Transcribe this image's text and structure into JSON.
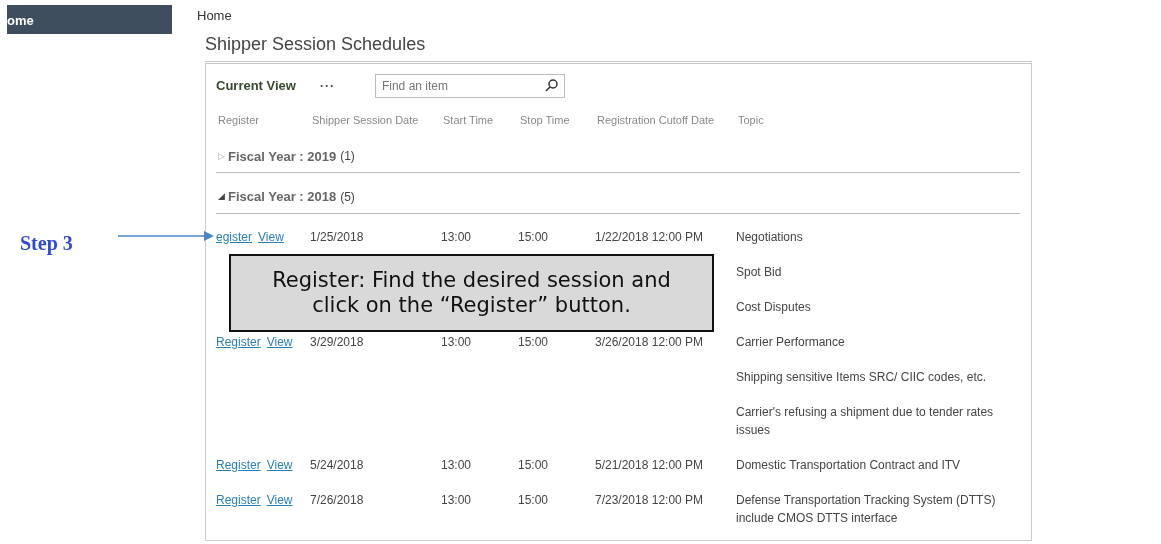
{
  "sidebar": {
    "items": [
      {
        "label": "ome",
        "selected": true
      }
    ]
  },
  "breadcrumb": "Home",
  "title": "Shipper Session Schedules",
  "toolbar": {
    "view_label": "Current View",
    "more": "···",
    "search": {
      "placeholder": "Find an item"
    }
  },
  "table": {
    "columns": [
      "Register",
      "Shipper Session Date",
      "Start Time",
      "Stop Time",
      "Registration Cutoff Date",
      "Topic"
    ],
    "groups": [
      {
        "toggle": "▷",
        "title": "Fiscal Year : 2019",
        "count": "(1)",
        "expanded": false
      },
      {
        "toggle": "◢",
        "title": "Fiscal Year : 2018",
        "count": "(5)",
        "expanded": true,
        "rows": [
          {
            "register": "egister",
            "view": "View",
            "date": "1/25/2018",
            "start": "13:00",
            "stop": "15:00",
            "cutoff": "1/22/2018 12:00 PM",
            "topic": "Negotiations"
          },
          {
            "topic": "Spot Bid"
          },
          {
            "topic": "Cost Disputes"
          },
          {
            "register": "Register",
            "view": "View",
            "date": "3/29/2018",
            "start": "13:00",
            "stop": "15:00",
            "cutoff": "3/26/2018 12:00 PM",
            "topic": "Carrier Performance"
          },
          {
            "topic": "Shipping sensitive Items SRC/ CIIC codes, etc."
          },
          {
            "topic": "Carrier's refusing a shipment due to tender rates issues"
          },
          {
            "register": "Register",
            "view": "View",
            "date": "5/24/2018",
            "start": "13:00",
            "stop": "15:00",
            "cutoff": "5/21/2018 12:00 PM",
            "topic": "Domestic Transportation Contract and ITV"
          },
          {
            "register": "Register",
            "view": "View",
            "date": "7/26/2018",
            "start": "13:00",
            "stop": "15:00",
            "cutoff": "7/23/2018 12:00 PM",
            "topic": "Defense Transportation Tracking System (DTTS) include CMOS DTTS interface"
          }
        ]
      }
    ]
  },
  "annotation": {
    "step": "Step 3",
    "callout": "Register: Find the desired session and click on the “Register” button."
  }
}
